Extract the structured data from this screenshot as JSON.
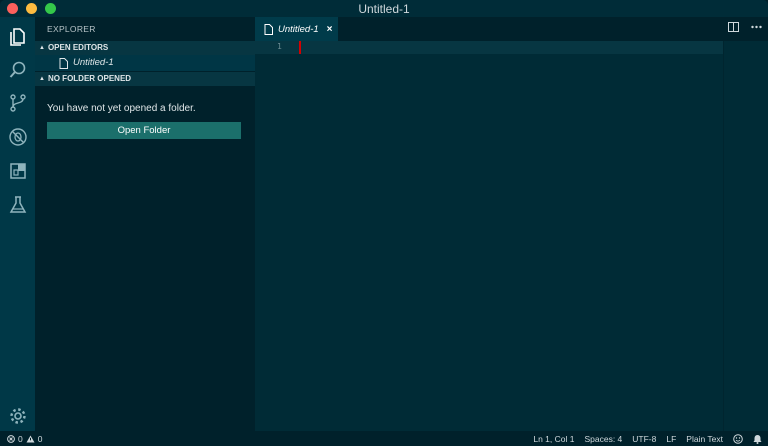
{
  "window": {
    "title": "Untitled-1"
  },
  "sidebar": {
    "title": "EXPLORER",
    "sections": {
      "open_editors": {
        "label": "OPEN EDITORS",
        "items": [
          {
            "label": "Untitled-1"
          }
        ]
      },
      "no_folder": {
        "label": "NO FOLDER OPENED",
        "message": "You have not yet opened a folder.",
        "button_label": "Open Folder"
      }
    }
  },
  "editor": {
    "tabs": [
      {
        "label": "Untitled-1",
        "close_glyph": "×"
      }
    ],
    "line_numbers": [
      "1"
    ]
  },
  "statusbar": {
    "errors": "0",
    "warnings": "0",
    "position": "Ln 1, Col 1",
    "spaces": "Spaces: 4",
    "encoding": "UTF-8",
    "eol": "LF",
    "language": "Plain Text"
  },
  "icons": {
    "activity": [
      "files-icon",
      "search-icon",
      "source-control-icon",
      "debug-icon",
      "extensions-icon",
      "test-flask-icon"
    ],
    "settings": "gear-icon"
  },
  "colors": {
    "cursor": "#d30102",
    "button": "#1b6f6b",
    "editor_bg": "#002b36",
    "sidebar_bg": "#00212b"
  }
}
